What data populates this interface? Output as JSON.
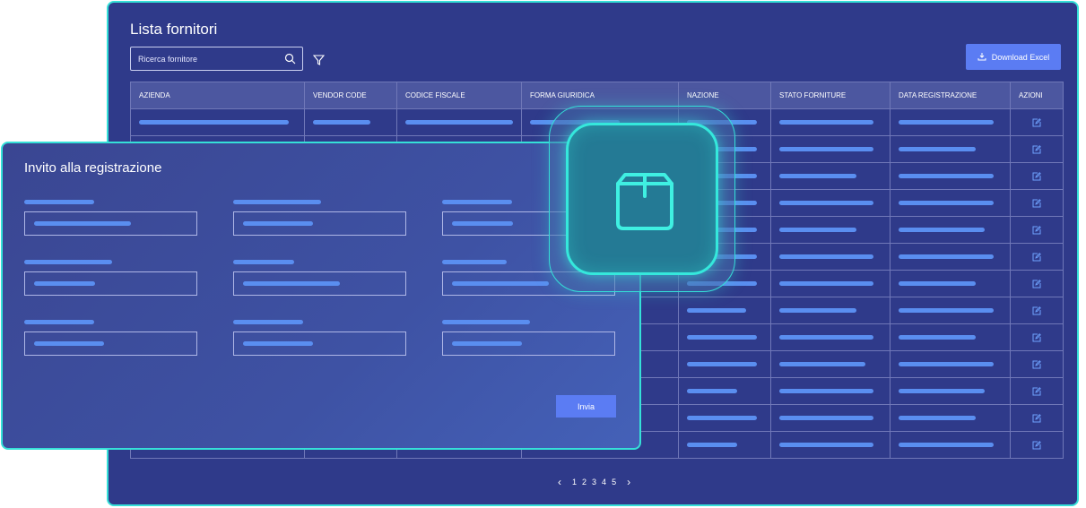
{
  "suppliers": {
    "title": "Lista fornitori",
    "search_placeholder": "Ricerca fornitore",
    "download_label": "Download Excel",
    "columns": [
      "AZIENDA",
      "VENDOR CODE",
      "CODICE FISCALE",
      "FORMA GIURIDICA",
      "NAZIONE",
      "STATO FORNITURE",
      "DATA REGISTRAZIONE",
      "AZIONI"
    ],
    "row_count": 13,
    "pagination": {
      "pages": [
        "1",
        "2",
        "3",
        "4",
        "5"
      ]
    }
  },
  "invite": {
    "title": "Invito alla registrazione",
    "send_label": "Invia"
  },
  "colors": {
    "panel_bg": "#2f3a8a",
    "accent_border": "#35e0d8",
    "placeholder_bar": "#5a8ef0",
    "button": "#5b7cf3"
  },
  "icons": [
    "search-icon",
    "filter-icon",
    "download-icon",
    "edit-icon",
    "box-icon",
    "chevron-left-icon",
    "chevron-right-icon"
  ]
}
